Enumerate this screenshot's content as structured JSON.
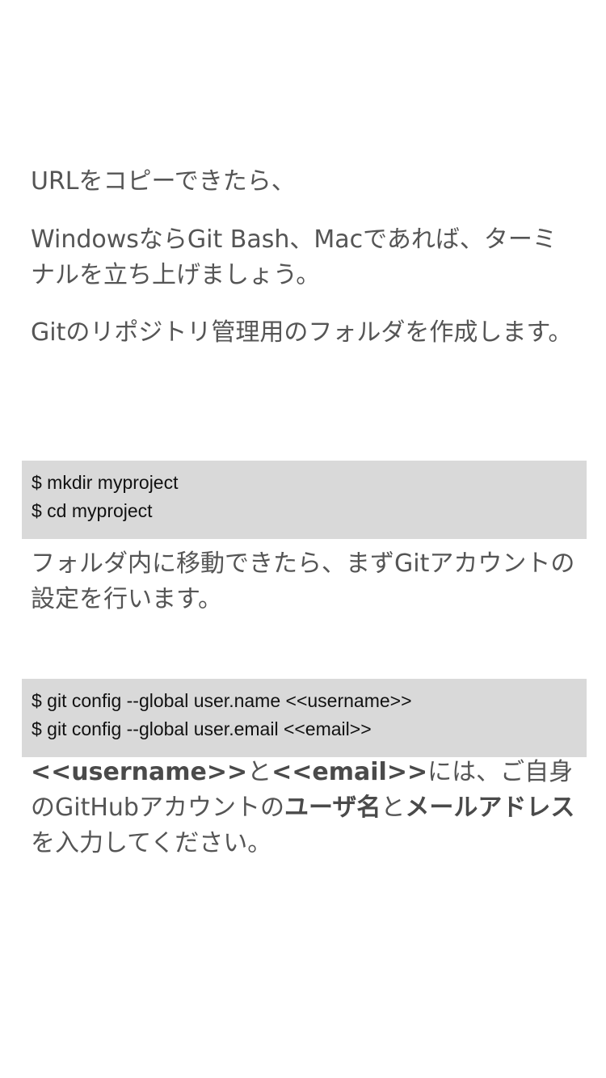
{
  "intro": {
    "line1": "URLをコピーできたら、",
    "line2": "WindowsならGit Bash、Macであれば、ターミナルを立ち上げましょう。",
    "line3": "Gitのリポジトリ管理用のフォルダを作成します。"
  },
  "code_mkdir": {
    "lines": [
      "$ mkdir myproject",
      "$ cd myproject"
    ]
  },
  "middle": {
    "text": "フォルダ内に移動できたら、まずGitアカウントの設定を行います。"
  },
  "code_config": {
    "lines": [
      "$ git config --global user.name <<username>>",
      "$ git config --global user.email <<email>>"
    ]
  },
  "closing": {
    "bold1": "<<username>>",
    "text1": "と",
    "bold2": "<<email>>",
    "text2": "には、ご自身のGitHubアカウントの",
    "bold3": "ユーザ名",
    "text3": "と",
    "bold4": "メールアドレス",
    "text4": "を入力してください。"
  }
}
